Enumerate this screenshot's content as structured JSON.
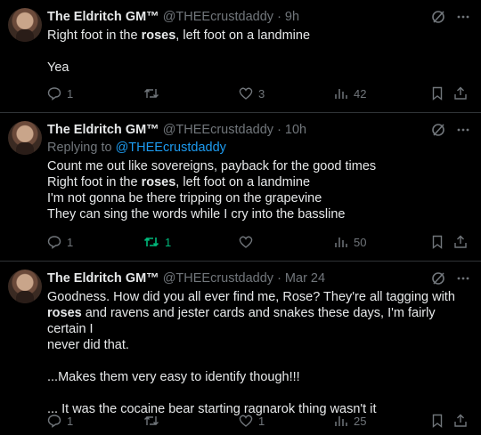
{
  "tweets": [
    {
      "name": "The Eldritch GM™",
      "handle": "@THEEcrustdaddy",
      "time": "· 9h",
      "reply_prefix": "",
      "reply_handle": "",
      "lines": [
        {
          "pre": "Right foot in the ",
          "bold": "roses",
          "post": ", left foot on a landmine"
        },
        {
          "pre": "",
          "bold": "",
          "post": ""
        },
        {
          "pre": "Yea",
          "bold": "",
          "post": ""
        }
      ],
      "actions": {
        "replies": "1",
        "retweets": "",
        "likes": "3",
        "views": "42"
      }
    },
    {
      "name": "The Eldritch GM™",
      "handle": "@THEEcrustdaddy",
      "time": "· 10h",
      "reply_prefix": "Replying to ",
      "reply_handle": "@THEEcrustdaddy",
      "lines": [
        {
          "pre": "Count me out like sovereigns, payback for the good times",
          "bold": "",
          "post": ""
        },
        {
          "pre": "Right foot in the ",
          "bold": "roses",
          "post": ", left foot on a landmine"
        },
        {
          "pre": "I'm not gonna be there tripping on the grapevine",
          "bold": "",
          "post": ""
        },
        {
          "pre": "They can sing the words while I cry into the bassline",
          "bold": "",
          "post": ""
        }
      ],
      "actions": {
        "replies": "1",
        "retweets": "1",
        "likes": "",
        "views": "50"
      }
    },
    {
      "name": "The Eldritch GM™",
      "handle": "@THEEcrustdaddy",
      "time": "· Mar 24",
      "reply_prefix": "",
      "reply_handle": "",
      "lines": [
        {
          "pre": "Goodness. How did you all ever find me, Rose? They're all tagging with",
          "bold": "",
          "post": ""
        },
        {
          "pre": "",
          "bold": "roses",
          "post": " and ravens and jester cards and snakes these days, I'm fairly certain I"
        },
        {
          "pre": "never did that.",
          "bold": "",
          "post": ""
        },
        {
          "pre": "",
          "bold": "",
          "post": ""
        },
        {
          "pre": "...Makes them very easy to identify though!!!",
          "bold": "",
          "post": ""
        },
        {
          "pre": "",
          "bold": "",
          "post": ""
        },
        {
          "pre": "... It was the cocaine bear starting ragnarok thing wasn't it",
          "bold": "",
          "post": ""
        }
      ],
      "actions": {
        "replies": "1",
        "retweets": "",
        "likes": "1",
        "views": "25"
      }
    }
  ],
  "colors": {
    "background": "#000000",
    "text": "#e7e9ea",
    "muted": "#71767b",
    "link": "#1d9bf0",
    "retweet_active": "#00ba7c",
    "divider": "#2f3336"
  },
  "icons": {
    "grok": "grok-icon",
    "more": "more-icon",
    "reply": "reply-icon",
    "retweet": "retweet-icon",
    "like": "heart-icon",
    "views": "views-icon",
    "bookmark": "bookmark-icon",
    "share": "share-icon"
  }
}
